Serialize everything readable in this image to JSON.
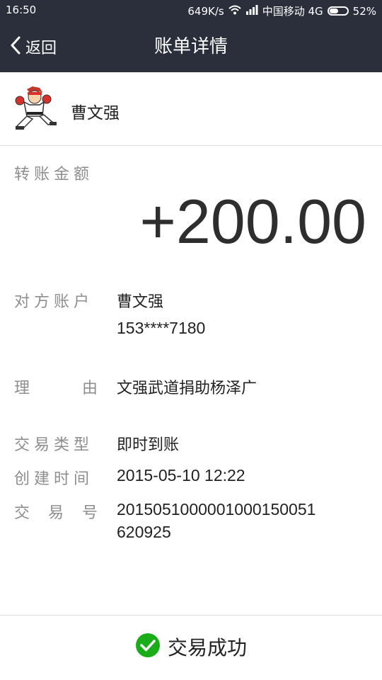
{
  "status_bar": {
    "time": "16:50",
    "speed": "649K/s",
    "carrier": "中国移动 4G",
    "battery": "52%",
    "battery_level": 0.52,
    "icons": [
      "wifi-icon",
      "signal-icon",
      "battery-icon"
    ]
  },
  "header": {
    "back_label": "返回",
    "title": "账单详情",
    "back_icon": "chevron-left-icon"
  },
  "payer": {
    "name": "曹文强",
    "avatar": "cartoon-fighter-avatar"
  },
  "amount": {
    "label": "转账金额",
    "value": "+200.00"
  },
  "details": {
    "account_label": "对方账户",
    "account_name": "曹文强",
    "account_phone": "153****7180",
    "reason_label_1": "理",
    "reason_label_2": "由",
    "reason": "文强武道捐助杨泽广",
    "type_label": "交易类型",
    "type": "即时到账",
    "created_label": "创建时间",
    "created": "2015-05-10 12:22",
    "txno_label_1": "交",
    "txno_label_2": "易",
    "txno_label_3": "号",
    "txno_line1": "201505100000100015005​1",
    "txno_line2": "620925"
  },
  "footer": {
    "status": "交易成功",
    "status_icon": "check-circle-icon",
    "accent_color": "#1aad19"
  },
  "colors": {
    "header_bg": "#2b2f3b",
    "label": "#8e8e8e",
    "divider": "#dcdcdc"
  }
}
